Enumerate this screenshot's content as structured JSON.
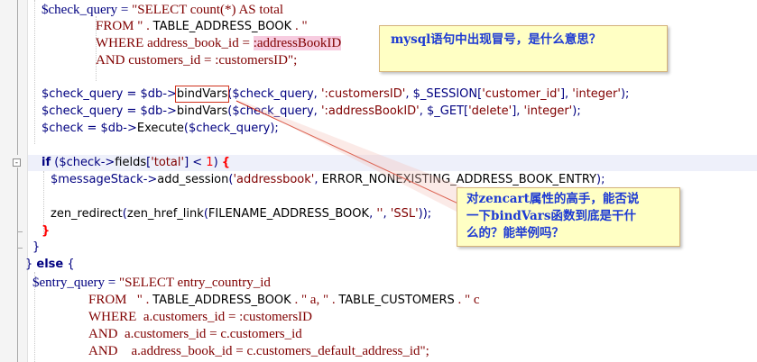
{
  "code_lines": [
    {
      "parts": [
        {
          "t": "$check_query",
          "c": "var"
        },
        {
          "t": " = ",
          "c": "op"
        },
        {
          "t": "\"SELECT count(*) AS total",
          "c": "str"
        }
      ]
    },
    {
      "parts": [
        {
          "t": "FROM \" . ",
          "c": "str"
        },
        {
          "t": "TABLE_ADDRESS_BOOK",
          "c": "fn"
        },
        {
          "t": " . \"",
          "c": "str"
        }
      ]
    },
    {
      "parts": [
        {
          "t": "WHERE address_book_id = ",
          "c": "str"
        },
        {
          "t": ":addressBookID",
          "c": "str pink"
        }
      ]
    },
    {
      "parts": [
        {
          "t": "AND customers_id = :customersID\";",
          "c": "str"
        }
      ]
    },
    {
      "parts": []
    },
    {
      "parts": [
        {
          "t": "$check_query",
          "c": "var"
        },
        {
          "t": " = ",
          "c": "op"
        },
        {
          "t": "$db",
          "c": "var"
        },
        {
          "t": "->",
          "c": "op"
        },
        {
          "t": "bindVars",
          "c": "fn box-red"
        },
        {
          "t": "(",
          "c": "op"
        },
        {
          "t": "$check_query",
          "c": "var"
        },
        {
          "t": ", ",
          "c": "op"
        },
        {
          "t": "':customersID'",
          "c": "str"
        },
        {
          "t": ", ",
          "c": "op"
        },
        {
          "t": "$_SESSION",
          "c": "var"
        },
        {
          "t": "[",
          "c": "op"
        },
        {
          "t": "'customer_id'",
          "c": "str"
        },
        {
          "t": "], ",
          "c": "op"
        },
        {
          "t": "'integer'",
          "c": "str"
        },
        {
          "t": ");",
          "c": "op"
        }
      ]
    },
    {
      "parts": [
        {
          "t": "$check_query",
          "c": "var"
        },
        {
          "t": " = ",
          "c": "op"
        },
        {
          "t": "$db",
          "c": "var"
        },
        {
          "t": "->",
          "c": "op"
        },
        {
          "t": "bindVars",
          "c": "fn"
        },
        {
          "t": "(",
          "c": "op"
        },
        {
          "t": "$check_query",
          "c": "var"
        },
        {
          "t": ", ",
          "c": "op"
        },
        {
          "t": "':addressBookID'",
          "c": "str"
        },
        {
          "t": ", ",
          "c": "op"
        },
        {
          "t": "$_GET",
          "c": "var"
        },
        {
          "t": "[",
          "c": "op"
        },
        {
          "t": "'delete'",
          "c": "str"
        },
        {
          "t": "], ",
          "c": "op"
        },
        {
          "t": "'integer'",
          "c": "str"
        },
        {
          "t": ");",
          "c": "op"
        }
      ]
    },
    {
      "parts": [
        {
          "t": "$check",
          "c": "var"
        },
        {
          "t": " = ",
          "c": "op"
        },
        {
          "t": "$db",
          "c": "var"
        },
        {
          "t": "->",
          "c": "op"
        },
        {
          "t": "Execute",
          "c": "fn"
        },
        {
          "t": "(",
          "c": "op"
        },
        {
          "t": "$check_query",
          "c": "var"
        },
        {
          "t": ");",
          "c": "op"
        }
      ]
    },
    {
      "parts": []
    },
    {
      "parts": [
        {
          "t": "if",
          "c": "kw"
        },
        {
          "t": " (",
          "c": "op"
        },
        {
          "t": "$check",
          "c": "var"
        },
        {
          "t": "->",
          "c": "op"
        },
        {
          "t": "fields",
          "c": "fn"
        },
        {
          "t": "[",
          "c": "op"
        },
        {
          "t": "'total'",
          "c": "str"
        },
        {
          "t": "] < ",
          "c": "op"
        },
        {
          "t": "1",
          "c": "num"
        },
        {
          "t": ") ",
          "c": "op"
        },
        {
          "t": "{",
          "c": "red"
        }
      ]
    },
    {
      "parts": [
        {
          "t": "$messageStack",
          "c": "var"
        },
        {
          "t": "->",
          "c": "op"
        },
        {
          "t": "add_session",
          "c": "fn"
        },
        {
          "t": "(",
          "c": "op"
        },
        {
          "t": "'addressbook'",
          "c": "str"
        },
        {
          "t": ", ",
          "c": "op"
        },
        {
          "t": "ERROR_NONEXISTING_ADDRESS_BOOK_ENTRY",
          "c": "fn"
        },
        {
          "t": ");",
          "c": "op"
        }
      ]
    },
    {
      "parts": []
    },
    {
      "parts": [
        {
          "t": "zen_redirect",
          "c": "fn"
        },
        {
          "t": "(",
          "c": "op"
        },
        {
          "t": "zen_href_link",
          "c": "fn"
        },
        {
          "t": "(",
          "c": "op"
        },
        {
          "t": "FILENAME_ADDRESS_BOOK",
          "c": "fn"
        },
        {
          "t": ", ",
          "c": "op"
        },
        {
          "t": "''",
          "c": "str"
        },
        {
          "t": ", ",
          "c": "op"
        },
        {
          "t": "'SSL'",
          "c": "str"
        },
        {
          "t": "));",
          "c": "op"
        }
      ]
    },
    {
      "parts": [
        {
          "t": "}",
          "c": "red"
        }
      ]
    },
    {
      "parts": [
        {
          "t": "}",
          "c": "op"
        }
      ]
    },
    {
      "parts": [
        {
          "t": "} ",
          "c": "op"
        },
        {
          "t": "else",
          "c": "kw"
        },
        {
          "t": " {",
          "c": "op"
        }
      ]
    },
    {
      "parts": [
        {
          "t": "$entry_query",
          "c": "var"
        },
        {
          "t": " = ",
          "c": "op"
        },
        {
          "t": "\"SELECT entry_country_id",
          "c": "str"
        }
      ]
    },
    {
      "parts": [
        {
          "t": "FROM   \" . ",
          "c": "str"
        },
        {
          "t": "TABLE_ADDRESS_BOOK",
          "c": "fn"
        },
        {
          "t": " . \" a, \" . ",
          "c": "str"
        },
        {
          "t": "TABLE_CUSTOMERS",
          "c": "fn"
        },
        {
          "t": " . \" c",
          "c": "str"
        }
      ]
    },
    {
      "parts": [
        {
          "t": "WHERE  a.customers_id = :customersID",
          "c": "str"
        }
      ]
    },
    {
      "parts": [
        {
          "t": "AND  a.customers_id = c.customers_id",
          "c": "str"
        }
      ]
    },
    {
      "parts": [
        {
          "t": "AND    a.address_book_id = c.customers_default_address_id\";",
          "c": "str"
        }
      ]
    }
  ],
  "callouts": {
    "mysql_question": "mysql语句中出现冒号，是什么意思？",
    "bindvars_question_line1": "对zencart属性的高手，能否说",
    "bindvars_question_line2": "一下bindVars函数到底是干什",
    "bindvars_question_line3": "么的？能举例吗？"
  },
  "fold_markers": {
    "collapse": "-"
  },
  "colors": {
    "variable": "#000080",
    "string": "#800000",
    "keyword": "#000080",
    "brace": "#ff0000",
    "callout_text": "#1d3ad3",
    "callout_bg": "#ffffc4",
    "annotation_box": "#d0311c"
  }
}
